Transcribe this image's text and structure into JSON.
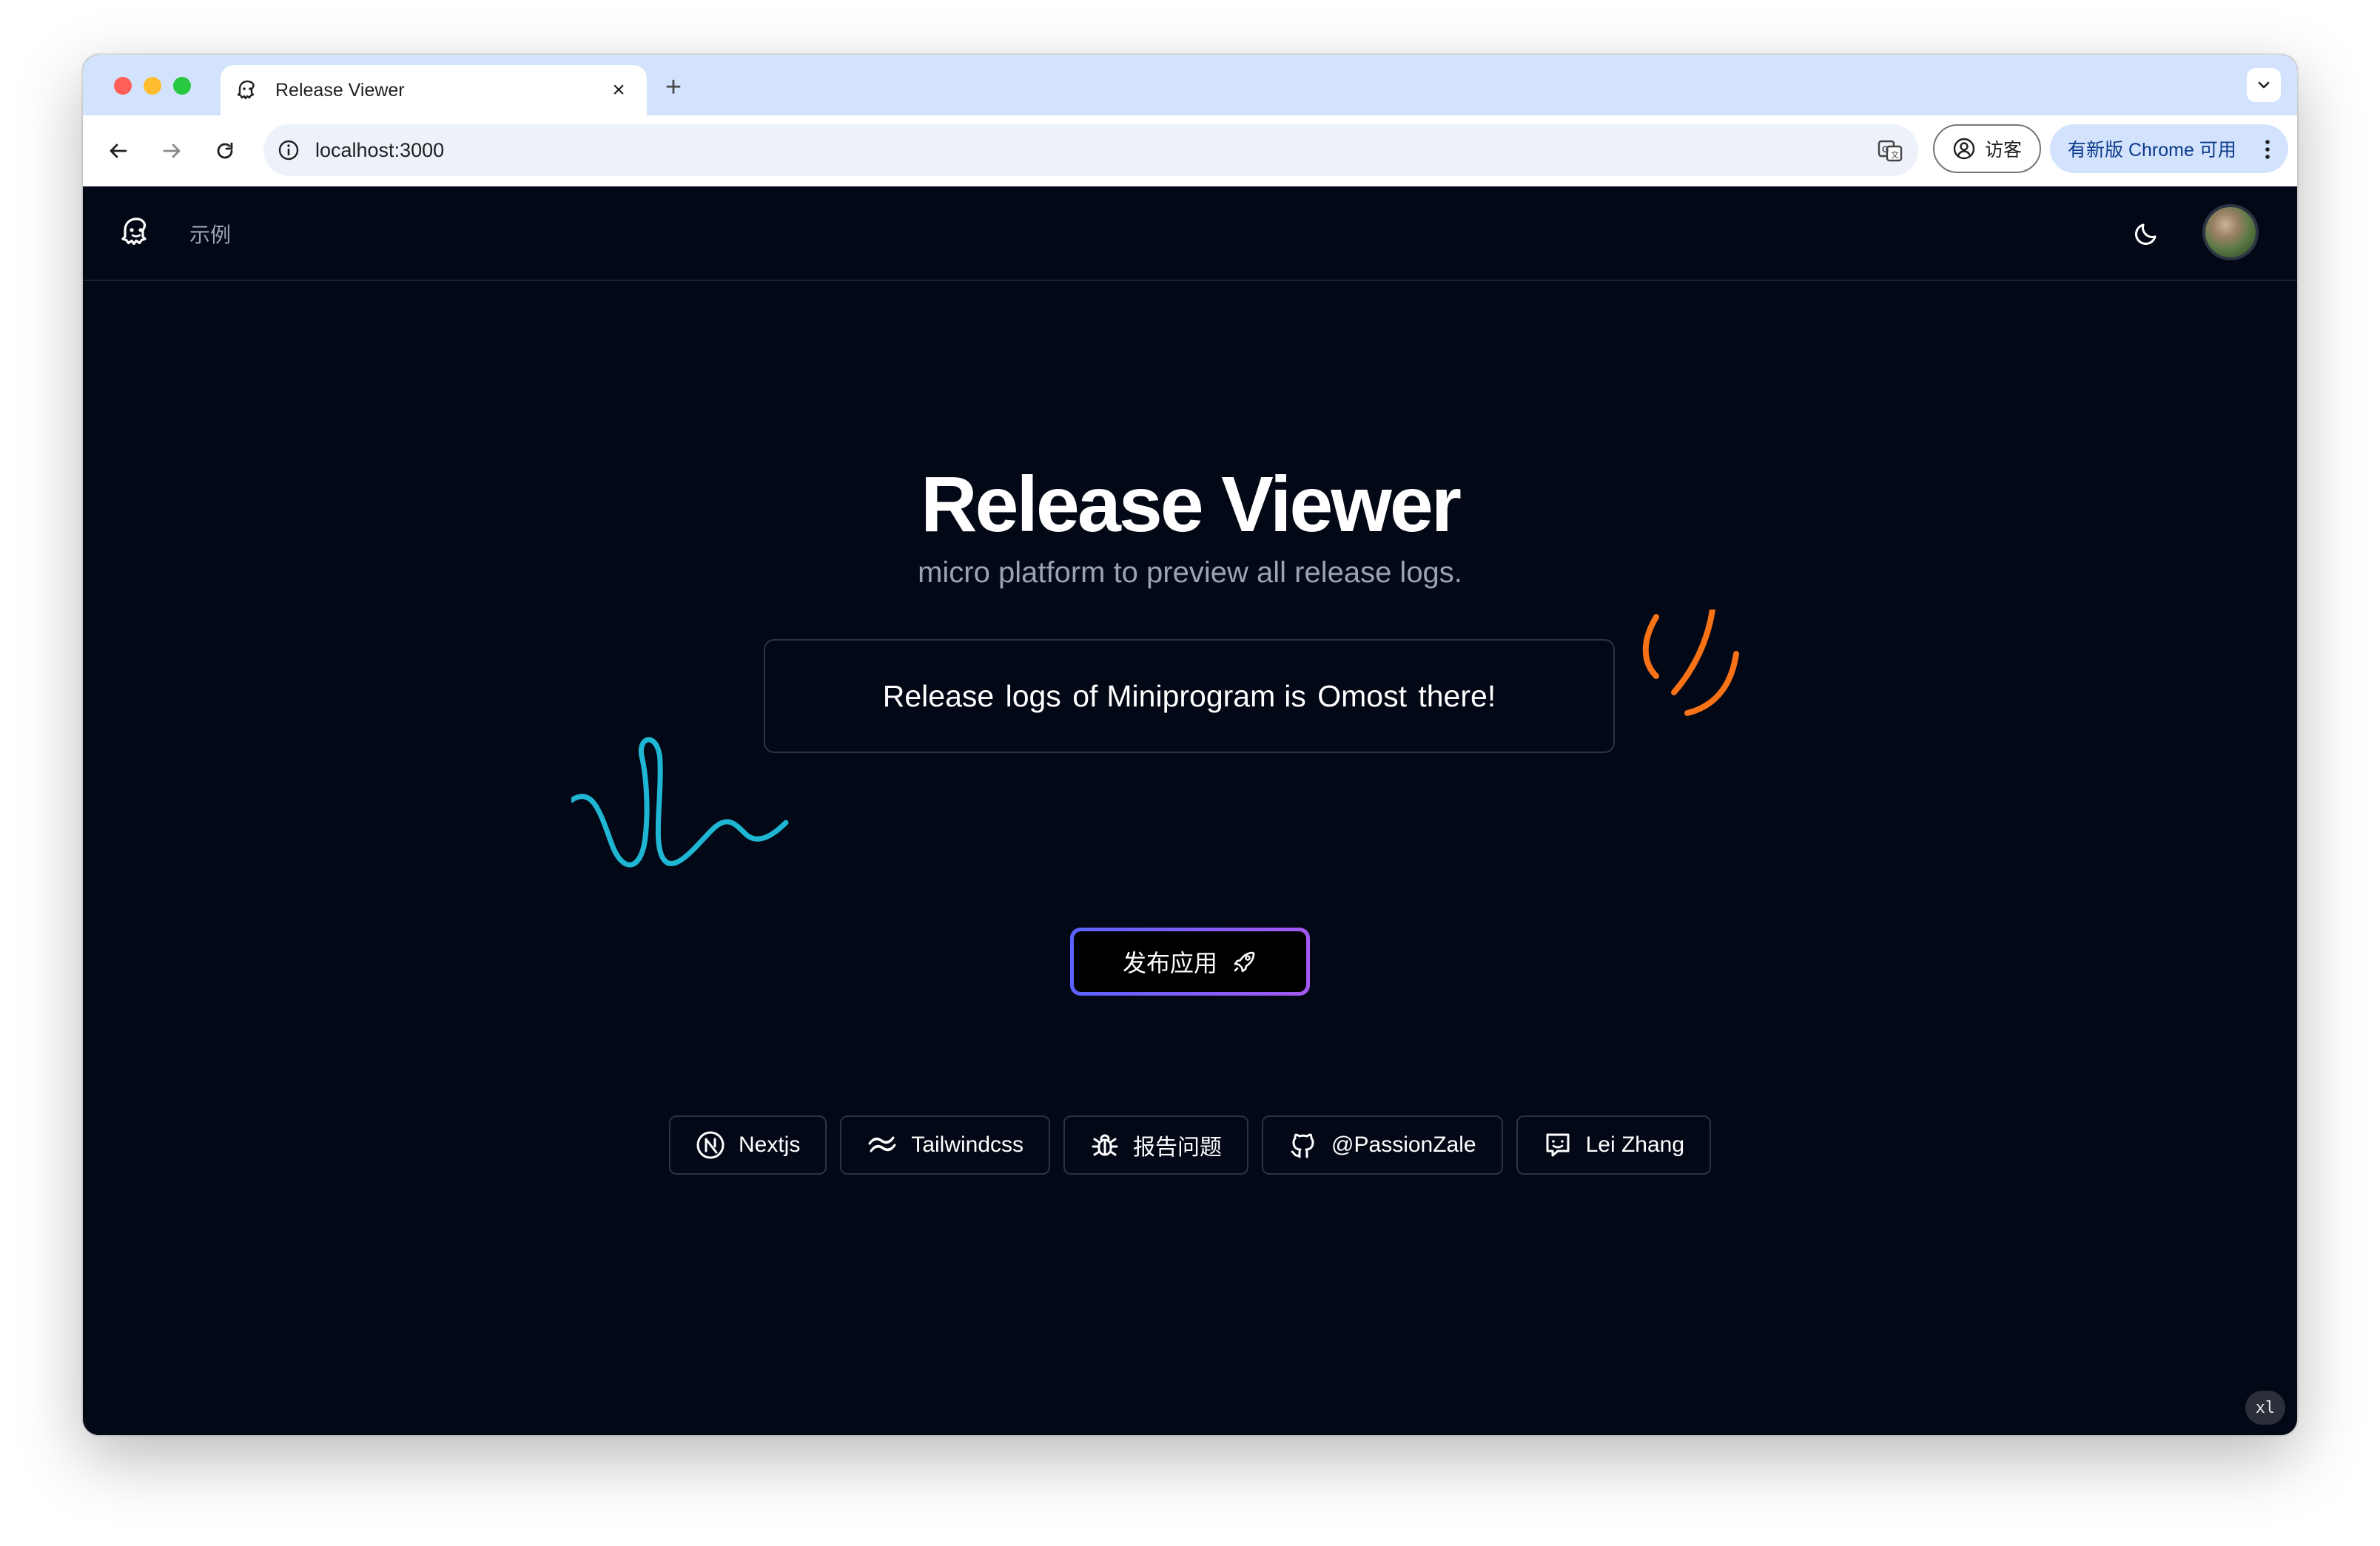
{
  "browser": {
    "tab_title": "Release Viewer",
    "tab_close": "×",
    "new_tab": "+",
    "url": "localhost:3000",
    "guest_label": "访客",
    "update_label": "有新版 Chrome 可用"
  },
  "site": {
    "nav_link": "示例",
    "title": "Release Viewer",
    "subtitle": "micro platform to preview all release logs.",
    "banner": {
      "part1": "Release logs of",
      "part2": "Miniprogram",
      "part3": "is Omost there!"
    },
    "publish_button": "发布应用",
    "links": [
      {
        "label": "Nextjs",
        "icon": "nextjs-icon"
      },
      {
        "label": "Tailwindcss",
        "icon": "tailwind-icon"
      },
      {
        "label": "报告问题",
        "icon": "bug-icon"
      },
      {
        "label": "@PassionZale",
        "icon": "github-icon"
      },
      {
        "label": "Lei Zhang",
        "icon": "chat-icon"
      }
    ],
    "corner_badge": "xl"
  },
  "colors": {
    "page_bg": "#030816",
    "accent_gradient_start": "#5b62ff",
    "accent_gradient_end": "#a459f0",
    "squiggle_blue": "#1fb6d4",
    "squiggle_orange": "#f97316"
  }
}
